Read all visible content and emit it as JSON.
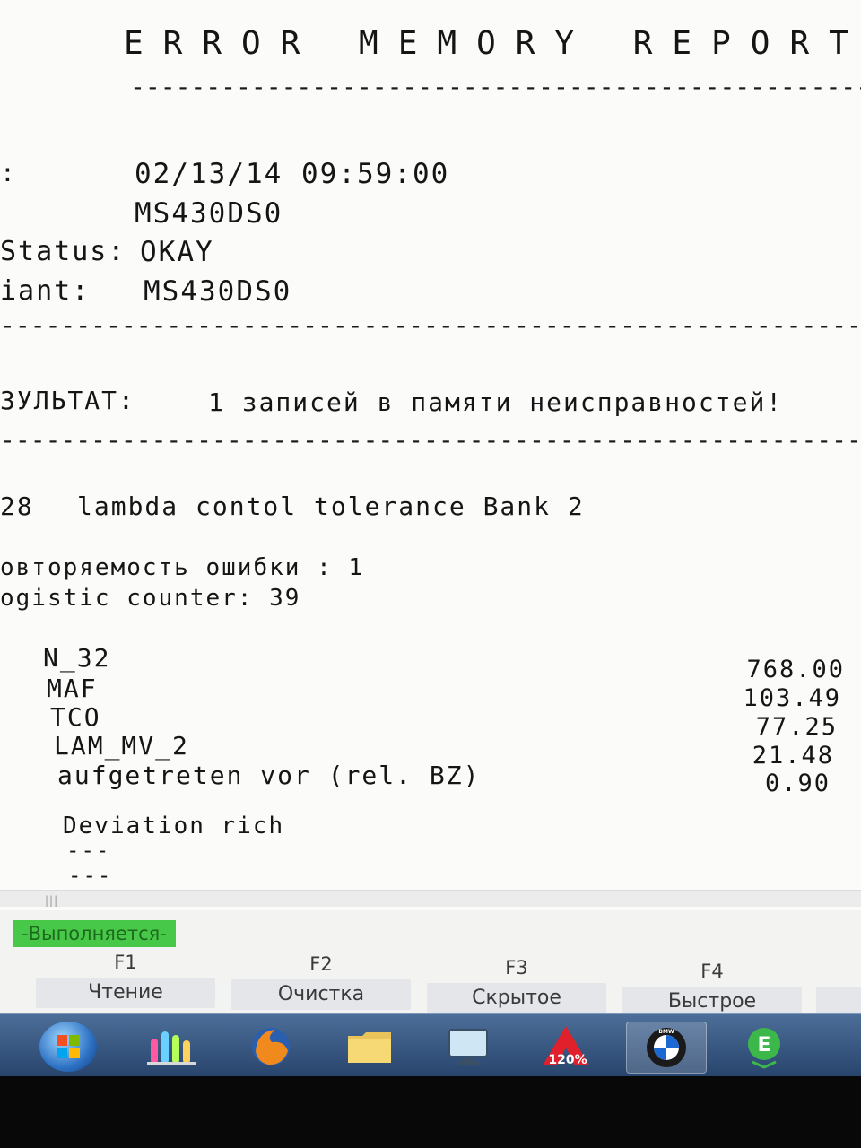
{
  "report": {
    "title": "ERROR MEMORY REPORT",
    "separator": "--------------------------------------------------------------------------------",
    "header": [
      {
        "label": ":",
        "value": "02/13/14 09:59:00"
      },
      {
        "label": "",
        "value": "MS430DS0"
      },
      {
        "label": "Status:",
        "value": "OKAY"
      },
      {
        "label": "iant:",
        "value": "MS430DS0"
      }
    ],
    "result_label": "ЗУЛЬТАТ:",
    "result_text": "1 записей в памяти неисправностей!",
    "fault": {
      "code": "28",
      "description": "lambda contol tolerance Bank 2"
    },
    "repeat_line": "овторяемость ошибки : 1",
    "logistic_line": "ogistic counter: 39",
    "parameters": [
      {
        "name": "N_32",
        "value": "768.00"
      },
      {
        "name": "MAF",
        "value": "103.49"
      },
      {
        "name": "TCO",
        "value": "77.25"
      },
      {
        "name": "LAM_MV_2",
        "value": "21.48"
      },
      {
        "name": "aufgetreten vor (rel. BZ)",
        "value": "0.90"
      }
    ],
    "deviation": "Deviation rich",
    "dash_lines": [
      "---",
      "---"
    ]
  },
  "scrollbar_grip": "|||",
  "status": {
    "text": "-Выполняется-",
    "color": "#48c848"
  },
  "function_keys": [
    {
      "key": "F1",
      "label": "Чтение"
    },
    {
      "key": "F2",
      "label": "Очистка"
    },
    {
      "key": "F3",
      "label": "Скрытое"
    },
    {
      "key": "F4",
      "label": "Быстрое"
    }
  ],
  "taskbar": {
    "items": [
      {
        "name": "start-orb",
        "icon": "windows-logo-icon"
      },
      {
        "name": "lab-app",
        "icon": "test-tubes-icon"
      },
      {
        "name": "firefox",
        "icon": "firefox-icon"
      },
      {
        "name": "folder",
        "icon": "folder-icon"
      },
      {
        "name": "computer",
        "icon": "monitor-icon"
      },
      {
        "name": "a120",
        "icon": "a120-icon"
      },
      {
        "name": "bmw",
        "icon": "bmw-logo-icon"
      },
      {
        "name": "e-app",
        "icon": "e-icon"
      }
    ],
    "a120_text": "120%",
    "bmw_text": "BMW",
    "e_text": "E"
  }
}
